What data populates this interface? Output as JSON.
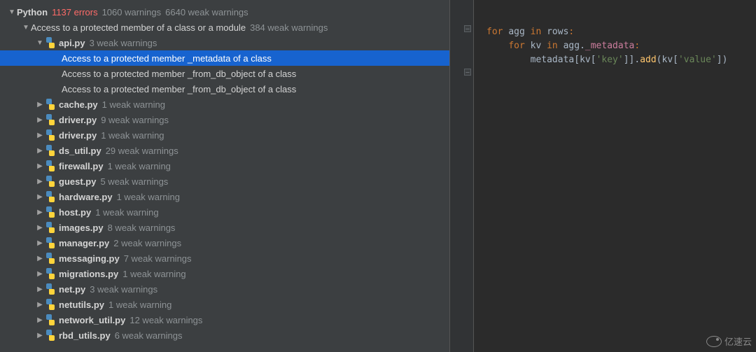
{
  "header": {
    "language": "Python",
    "errors_label": "1137 errors",
    "warnings_label": "1060 warnings",
    "weak_label": "6640 weak warnings"
  },
  "group": {
    "title": "Access to a protected member of a class or a module",
    "weak": "384 weak warnings"
  },
  "api_file": {
    "name": "api.py",
    "weak": "3 weak warnings",
    "issues": [
      "Access to a protected member _metadata of a class",
      "Access to a protected member _from_db_object of a class",
      "Access to a protected member _from_db_object of a class"
    ]
  },
  "files": [
    {
      "name": "cache.py",
      "weak": "1 weak warning"
    },
    {
      "name": "driver.py",
      "weak": "9 weak warnings"
    },
    {
      "name": "driver.py",
      "weak": "1 weak warning"
    },
    {
      "name": "ds_util.py",
      "weak": "29 weak warnings"
    },
    {
      "name": "firewall.py",
      "weak": "1 weak warning"
    },
    {
      "name": "guest.py",
      "weak": "5 weak warnings"
    },
    {
      "name": "hardware.py",
      "weak": "1 weak warning"
    },
    {
      "name": "host.py",
      "weak": "1 weak warning"
    },
    {
      "name": "images.py",
      "weak": "8 weak warnings"
    },
    {
      "name": "manager.py",
      "weak": "2 weak warnings"
    },
    {
      "name": "messaging.py",
      "weak": "7 weak warnings"
    },
    {
      "name": "migrations.py",
      "weak": "1 weak warning"
    },
    {
      "name": "net.py",
      "weak": "3 weak warnings"
    },
    {
      "name": "netutils.py",
      "weak": "1 weak warning"
    },
    {
      "name": "network_util.py",
      "weak": "12 weak warnings"
    },
    {
      "name": "rbd_utils.py",
      "weak": "6 weak warnings"
    }
  ],
  "code": {
    "kw_for": "for",
    "kw_in": "in",
    "var_agg": "agg",
    "var_rows": "rows",
    "var_kv": "kv",
    "attr_metadata": "_metadata",
    "var_metadata": "metadata",
    "str_key": "'key'",
    "str_value": "'value'",
    "call_add": "add"
  },
  "watermark": "亿速云"
}
